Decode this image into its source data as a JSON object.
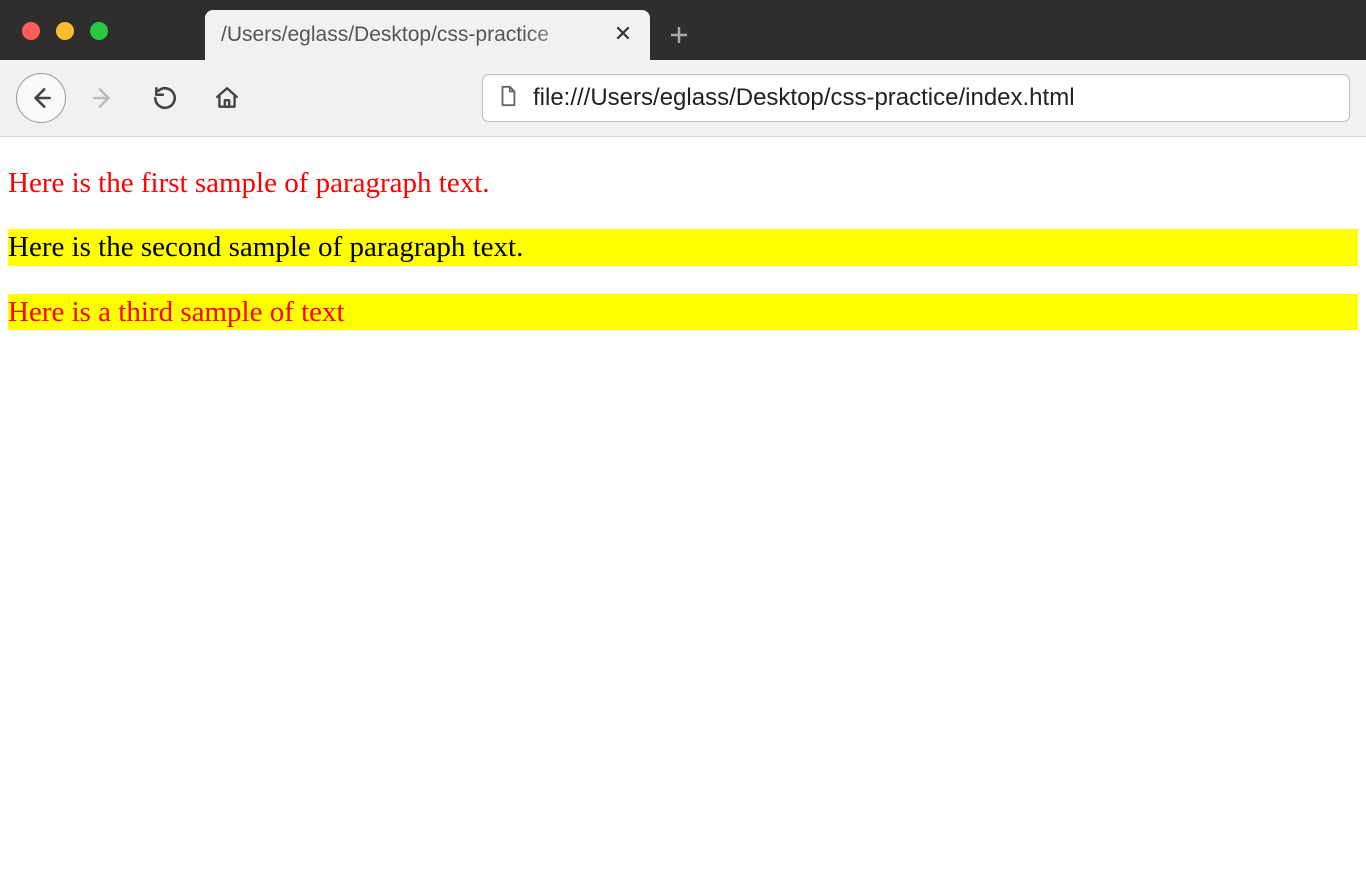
{
  "window": {
    "tab_title": "/Users/eglass/Desktop/css-practice"
  },
  "toolbar": {
    "url": "file:///Users/eglass/Desktop/css-practice/index.html"
  },
  "content": {
    "paragraph1": "Here is the first sample of paragraph text.",
    "paragraph2": "Here is the second sample of paragraph text.",
    "paragraph3": "Here is a third sample of text"
  }
}
